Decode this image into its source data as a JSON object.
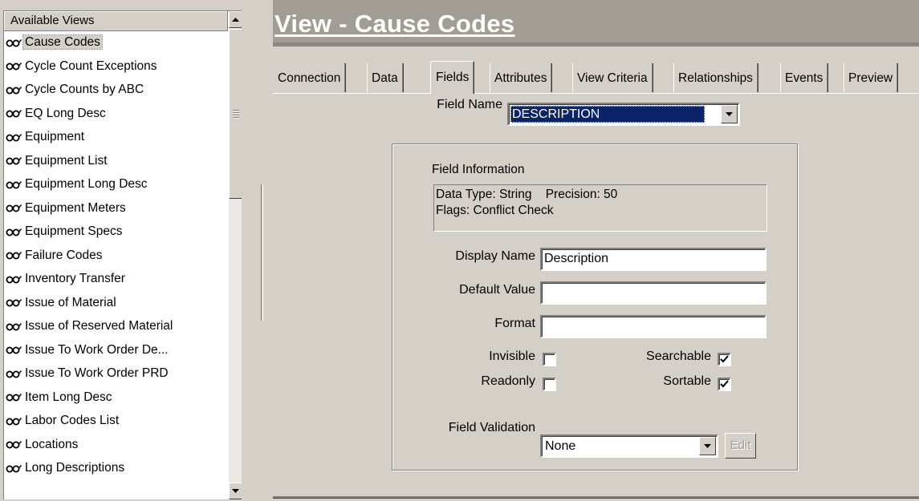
{
  "views_panel": {
    "header": "Available Views",
    "items": [
      {
        "label": "Cause Codes",
        "selected": true
      },
      {
        "label": "Cycle Count Exceptions"
      },
      {
        "label": "Cycle Counts by ABC"
      },
      {
        "label": "EQ Long Desc"
      },
      {
        "label": "Equipment"
      },
      {
        "label": "Equipment List"
      },
      {
        "label": "Equipment Long Desc"
      },
      {
        "label": "Equipment Meters"
      },
      {
        "label": "Equipment Specs"
      },
      {
        "label": "Failure Codes"
      },
      {
        "label": "Inventory Transfer"
      },
      {
        "label": "Issue of Material"
      },
      {
        "label": "Issue of Reserved Material"
      },
      {
        "label": "Issue To Work Order De..."
      },
      {
        "label": "Issue To Work Order PRD"
      },
      {
        "label": "Item Long Desc"
      },
      {
        "label": "Labor Codes List"
      },
      {
        "label": "Locations"
      },
      {
        "label": "Long Descriptions"
      }
    ],
    "item_icon": "glasses-icon"
  },
  "title": "View - Cause Codes",
  "tabs": [
    {
      "label": "Connection"
    },
    {
      "label": "Data"
    },
    {
      "label": "Fields",
      "active": true
    },
    {
      "label": "Attributes"
    },
    {
      "label": "View Criteria"
    },
    {
      "label": "Relationships"
    },
    {
      "label": "Events"
    },
    {
      "label": "Preview"
    }
  ],
  "fields_tab": {
    "field_name_label": "Field Name",
    "field_name_value": "DESCRIPTION",
    "info_title": "Field Information",
    "info_line1": "Data Type: String    Precision: 50",
    "info_line2": "Flags: Conflict Check",
    "display_name_label": "Display Name",
    "display_name_value": "Description",
    "default_value_label": "Default Value",
    "default_value_value": "",
    "format_label": "Format",
    "format_value": "",
    "invisible_label": "Invisible",
    "invisible_checked": false,
    "readonly_label": "Readonly",
    "readonly_checked": false,
    "searchable_label": "Searchable",
    "searchable_checked": true,
    "sortable_label": "Sortable",
    "sortable_checked": true,
    "validation_label": "Field Validation",
    "validation_value": "None",
    "edit_label": "Edit"
  },
  "colors": {
    "window_bg": "#d4d0c8",
    "title_bar": "#a19c94",
    "selection": "#0a246a"
  }
}
